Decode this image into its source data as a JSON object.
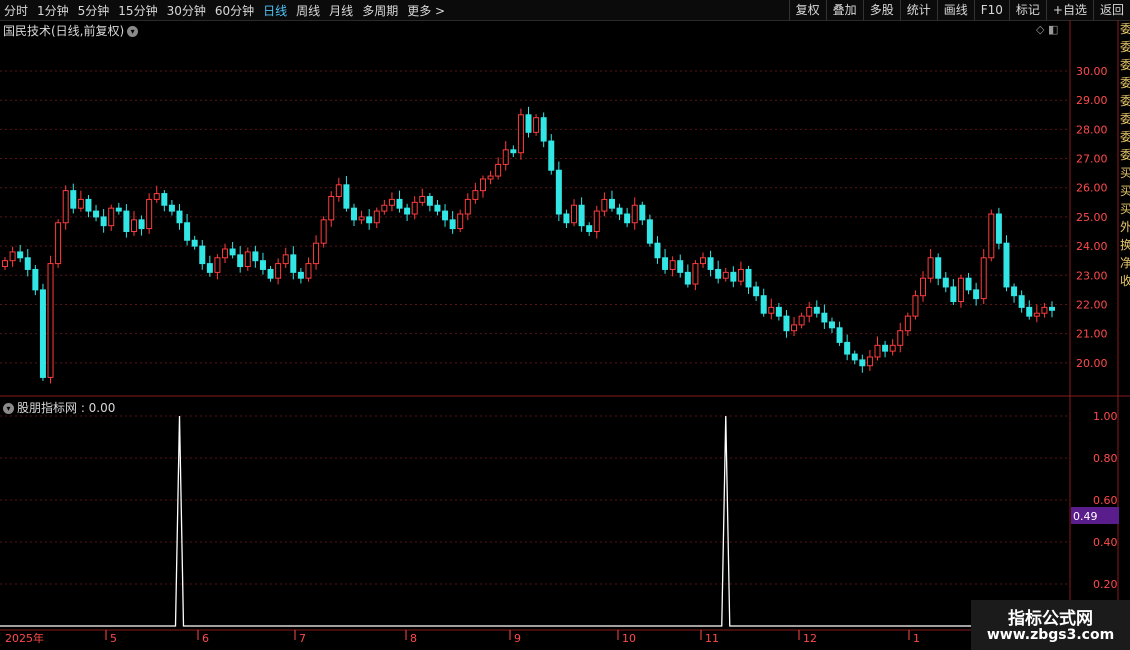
{
  "toolbar": {
    "periods": [
      "分时",
      "1分钟",
      "5分钟",
      "15分钟",
      "30分钟",
      "60分钟",
      "日线",
      "周线",
      "月线",
      "多周期",
      "更多 >"
    ],
    "active_period": "日线",
    "actions": [
      "复权",
      "叠加",
      "多股",
      "统计",
      "画线",
      "F10",
      "标记",
      "+自选",
      "返回"
    ]
  },
  "price_pane": {
    "title": "国民技术(日线,前复权)",
    "axis_ticks": [
      "30.00",
      "29.00",
      "28.00",
      "27.00",
      "26.00",
      "25.00",
      "24.00",
      "23.00",
      "22.00",
      "21.00",
      "20.00"
    ]
  },
  "indicator_pane": {
    "title": "股朋指标网 : 0.00",
    "axis_ticks": [
      "1.00",
      "0.80",
      "0.60",
      "0.40",
      "0.20"
    ],
    "highlight_value": "0.49"
  },
  "date_axis": [
    "2025年",
    "5",
    "6",
    "7",
    "8",
    "9",
    "10",
    "11",
    "12",
    "1"
  ],
  "right_column_text": "委委委委委委委委买买买外换净收",
  "watermark": {
    "title": "指标公式网",
    "url": "www.zbgs3.com"
  },
  "colors": {
    "up": "#ff3c3c",
    "down": "#33e6e6",
    "grid": "#5a1515",
    "axis_text": "#ff4a4a",
    "highlight_bg": "#5a1d8c"
  },
  "chart_data": [
    {
      "type": "candlestick",
      "title": "国民技术(日线,前复权)",
      "ylim": [
        19.0,
        31.2
      ],
      "x_labels": [
        "2025年",
        "5",
        "6",
        "7",
        "8",
        "9",
        "10",
        "11",
        "12",
        "1"
      ],
      "series": [
        {
          "close": [
            23.5,
            23.8,
            23.6,
            23.2,
            22.5,
            19.5,
            23.4,
            24.8,
            25.9,
            25.3,
            25.6,
            25.2,
            25.0,
            24.7,
            25.3,
            25.2,
            24.5,
            24.9,
            24.6,
            25.6,
            25.8,
            25.4,
            25.2,
            24.8,
            24.2,
            24.0,
            23.4,
            23.1,
            23.6,
            23.9,
            23.7,
            23.3,
            23.8,
            23.5,
            23.2,
            22.9,
            23.4,
            23.7,
            23.1,
            22.9,
            23.4,
            24.1,
            24.9,
            25.7,
            26.1,
            25.3,
            24.9,
            25.0,
            24.8,
            25.2,
            25.4,
            25.6,
            25.3,
            25.1,
            25.5,
            25.7,
            25.4,
            25.2,
            24.9,
            24.6,
            25.1,
            25.6,
            25.9,
            26.3,
            26.4,
            26.8,
            27.3,
            27.2,
            28.5,
            27.9,
            28.4,
            27.6,
            26.6,
            25.1,
            24.8,
            25.4,
            24.7,
            24.5,
            25.2,
            25.6,
            25.3,
            25.1,
            24.8,
            25.4,
            24.9,
            24.1,
            23.6,
            23.2,
            23.5,
            23.1,
            22.7,
            23.4,
            23.6,
            23.2,
            22.9,
            23.1,
            22.8,
            23.2,
            22.6,
            22.3,
            21.7,
            21.9,
            21.6,
            21.1,
            21.3,
            21.6,
            21.9,
            21.7,
            21.4,
            21.2,
            20.7,
            20.3,
            20.1,
            19.9,
            20.2,
            20.6,
            20.4,
            20.6,
            21.1,
            21.6,
            22.3,
            22.9,
            23.6,
            22.9,
            22.6,
            22.1,
            22.9,
            22.5,
            22.2,
            23.6,
            25.1,
            24.1,
            22.6,
            22.3,
            21.9,
            21.6,
            21.7,
            21.9,
            21.8
          ]
        }
      ]
    },
    {
      "type": "line",
      "title": "股朋指标网 : 0.00",
      "ylim": [
        0,
        1.05
      ],
      "series": [
        {
          "name": "",
          "spikes_at_bar": [
            23,
            95
          ],
          "values_default": 0.0
        }
      ]
    }
  ]
}
